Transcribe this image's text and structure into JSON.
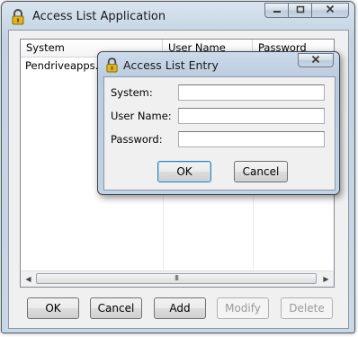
{
  "window": {
    "title": "Access List Application",
    "list": {
      "columns": [
        "System",
        "User Name",
        "Password"
      ],
      "rows": [
        [
          "Pendriveapps.com",
          "",
          ""
        ]
      ]
    },
    "buttons": {
      "ok": "OK",
      "cancel": "Cancel",
      "add": "Add",
      "modify": "Modify",
      "delete": "Delete"
    },
    "scroll_grip": "III"
  },
  "dialog": {
    "title": "Access List Entry",
    "fields": {
      "system_label": "System:",
      "user_label": "User Name:",
      "password_label": "Password:",
      "system_value": "",
      "user_value": "",
      "password_value": ""
    },
    "ok": "OK",
    "cancel": "Cancel"
  },
  "icons": {
    "app": "padlock-icon",
    "minimize": "minimize-icon",
    "maximize": "maximize-icon",
    "close": "close-icon"
  },
  "colors": {
    "titlebar": "#c3d3e3",
    "lock_body": "#e0b520",
    "default_button_border": "#3c7fb1"
  }
}
